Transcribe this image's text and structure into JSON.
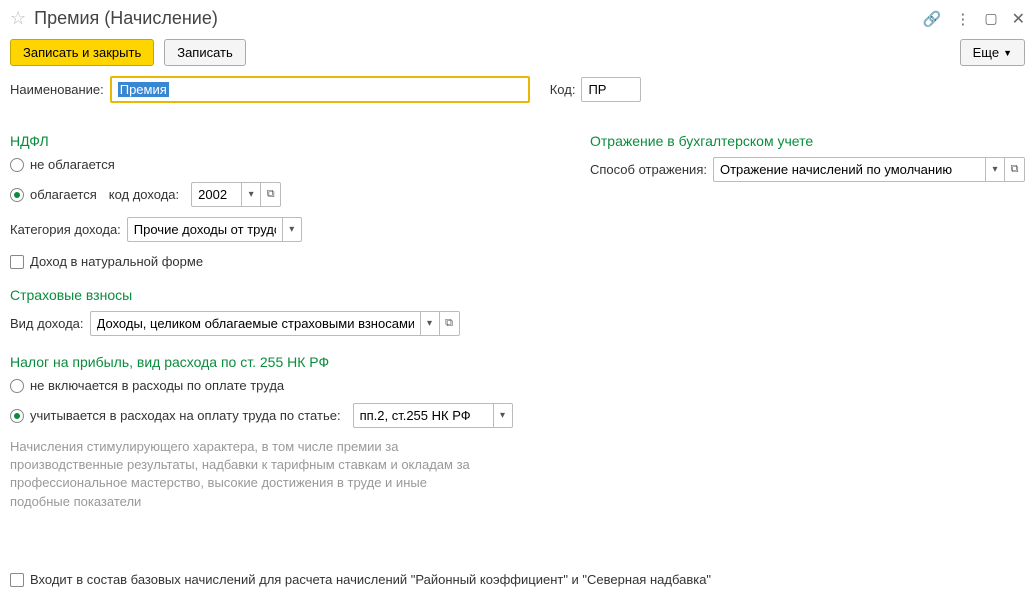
{
  "header": {
    "title": "Премия (Начисление)"
  },
  "toolbar": {
    "save_close": "Записать и закрыть",
    "save": "Записать",
    "more": "Еще"
  },
  "fields": {
    "name_label": "Наименование:",
    "name_value": "Премия",
    "code_label": "Код:",
    "code_value": "ПР"
  },
  "ndfl": {
    "title": "НДФЛ",
    "opt_not_taxed": "не облагается",
    "opt_taxed": "облагается",
    "income_code_label": "код дохода:",
    "income_code_value": "2002",
    "category_label": "Категория дохода:",
    "category_value": "Прочие доходы от трудов",
    "natural_income": "Доход в натуральной форме"
  },
  "accounting": {
    "title": "Отражение в бухгалтерском учете",
    "method_label": "Способ отражения:",
    "method_value": "Отражение начислений по умолчанию"
  },
  "insurance": {
    "title": "Страховые взносы",
    "income_type_label": "Вид дохода:",
    "income_type_value": "Доходы, целиком облагаемые страховыми взносами"
  },
  "profit_tax": {
    "title": "Налог на прибыль, вид расхода по ст. 255 НК РФ",
    "opt_not_included": "не включается в расходы по оплате труда",
    "opt_included": "учитывается в расходах на оплату труда по статье:",
    "article_value": "пп.2, ст.255 НК РФ",
    "description": "Начисления стимулирующего характера, в том числе премии за производственные результаты, надбавки к тарифным ставкам и окладам за профессиональное мастерство, высокие достижения в труде и иные подобные показатели"
  },
  "footer": {
    "base_accruals": "Входит в состав базовых начислений для расчета начислений \"Районный коэффициент\" и \"Северная надбавка\""
  }
}
